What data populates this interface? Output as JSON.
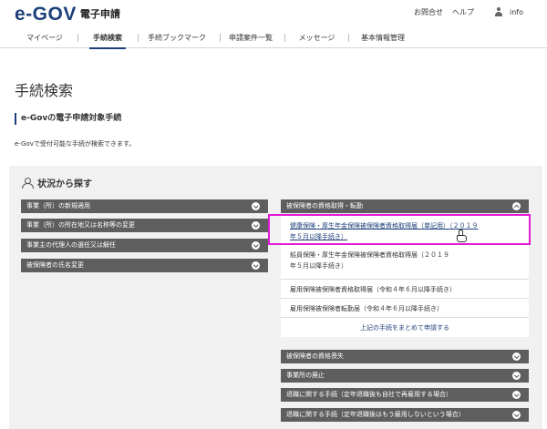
{
  "header": {
    "logo_text": "e-GOV",
    "logo_sub": "電子申請",
    "links": {
      "inquiry": "お問合せ",
      "help": "ヘルプ",
      "user": "info"
    }
  },
  "nav": {
    "items": [
      "マイページ",
      "手続検索",
      "手続ブックマーク",
      "申請案件一覧",
      "メッセージ",
      "基本情報管理"
    ],
    "active": "手続検索"
  },
  "page": {
    "title": "手続検索",
    "section_title": "e-Govの電子申請対象手続",
    "description": "e-Govで受付可能な手続が検索できます。"
  },
  "panel": {
    "title": "状況から探す",
    "left_categories": [
      "事業（所）の新規適用",
      "事業（所）の所在地又は名称等の変更",
      "事業主の代理人の選任又は解任",
      "被保険者の氏名変更"
    ],
    "right_open_category": "被保険者の資格取得・転勤",
    "procedures": [
      {
        "line1": "健康保険・厚生年金保険被保険者資格取得届（単記用）（２０１９",
        "line2": "年５月以降手続き）"
      },
      {
        "line1": "船員保険・厚生年金保険被保険者資格取得届（２０１９",
        "line2": "年５月以降手続き）"
      },
      {
        "line1": "雇用保険被保険者資格取得届（令和４年６月以降手続き）"
      },
      {
        "line1": "雇用保険被保険者転勤届（令和４年６月以降手続き）"
      }
    ],
    "bulk_apply": "上記の手続をまとめて申請する",
    "right_categories": [
      "被保険者の資格喪失",
      "事業所の廃止",
      "退職に関する手続（定年退職後も自社で再雇用する場合）",
      "退職に関する手続（定年退職後はもう雇用しないという場合）"
    ]
  },
  "colors": {
    "brand": "#1c3f7a",
    "bar": "#5e5e5e",
    "highlight": "#e21ad8",
    "panel_bg": "#f1f1f1"
  }
}
